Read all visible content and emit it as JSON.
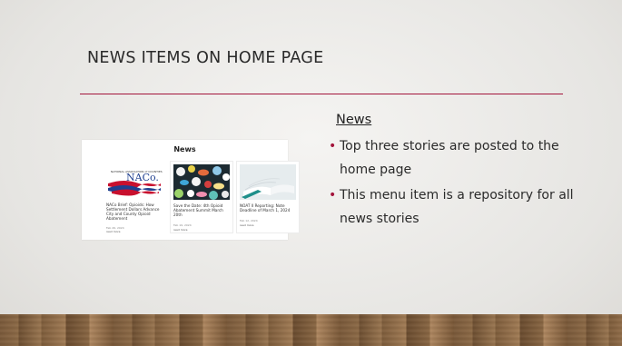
{
  "slide": {
    "title": "NEWS ITEMS ON HOME PAGE",
    "accent_color": "#a3143b"
  },
  "content": {
    "heading": "News",
    "bullets": [
      "Top three stories are posted to the home page",
      "This menu item is a repository for all news stories"
    ]
  },
  "screenshot": {
    "title": "News",
    "logo_text_small": "NATIONAL ASSOCIATION of COUNTIES",
    "logo_text": "NACo.",
    "cards": [
      {
        "caption": "NACo Brief: Opioids: How Settlement Dollars Advance City and County Opioid Abatement",
        "date": "Feb 26, 2024",
        "link": "read more"
      },
      {
        "caption": "Save the Date: 4th Opioid Abatement Summit March 20th",
        "date": "Feb 19, 2024",
        "link": "read more"
      },
      {
        "caption": "NOAT II Reporting: Note Deadline of March 1, 2024",
        "date": "Feb 12, 2024",
        "link": "read more"
      }
    ]
  }
}
